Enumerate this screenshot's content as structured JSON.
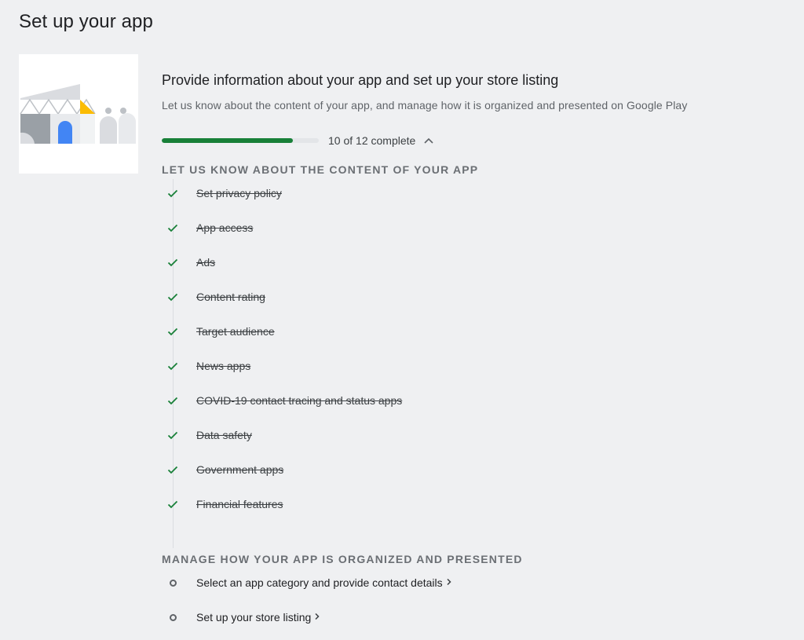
{
  "page": {
    "title": "Set up your app"
  },
  "card": {
    "title": "Provide information about your app and set up your store listing",
    "subtitle": "Let us know about the content of your app, and manage how it is organized and presented on Google Play",
    "progress": {
      "completed": 10,
      "total": 12,
      "label": "10 of 12 complete",
      "fill_color": "#188038",
      "collapse_icon": "chevron-up-icon"
    }
  },
  "sections": [
    {
      "header": "Let us know about the content of your app",
      "tasks": [
        {
          "label": "Set privacy policy",
          "done": true
        },
        {
          "label": "App access",
          "done": true
        },
        {
          "label": "Ads",
          "done": true
        },
        {
          "label": "Content rating",
          "done": true
        },
        {
          "label": "Target audience",
          "done": true
        },
        {
          "label": "News apps",
          "done": true
        },
        {
          "label": "COVID-19 contact tracing and status apps",
          "done": true
        },
        {
          "label": "Data safety",
          "done": true
        },
        {
          "label": "Government apps",
          "done": true
        },
        {
          "label": "Financial features",
          "done": true
        }
      ]
    },
    {
      "header": "Manage how your app is organized and presented",
      "tasks": [
        {
          "label": "Select an app category and provide contact details",
          "done": false
        },
        {
          "label": "Set up your store listing",
          "done": false
        }
      ]
    }
  ],
  "colors": {
    "check": "#188038",
    "background": "#eff0f2"
  }
}
